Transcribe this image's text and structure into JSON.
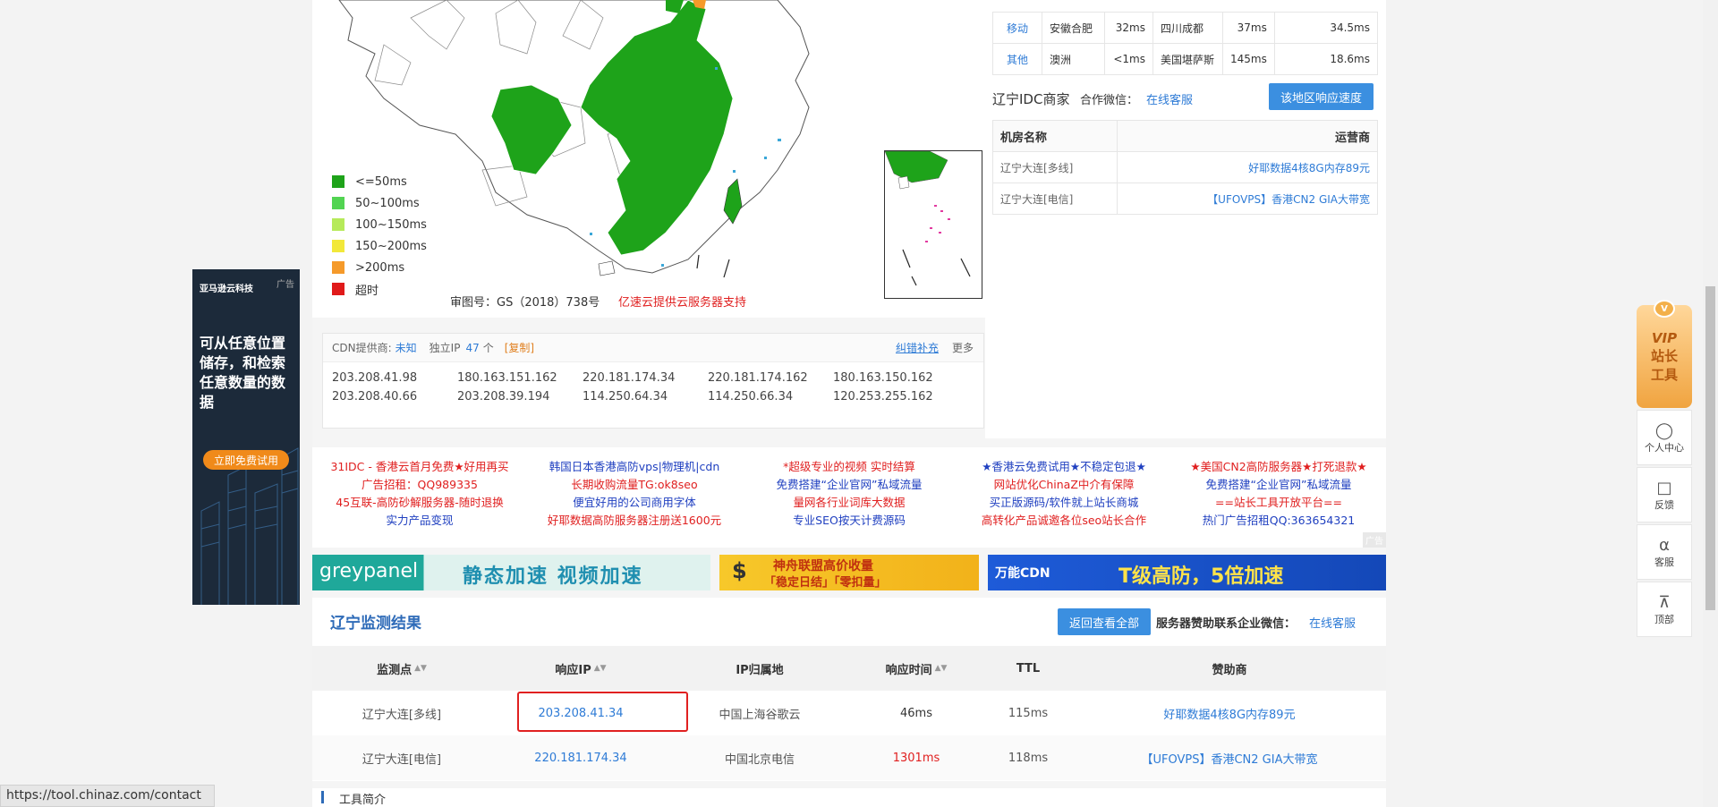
{
  "map": {
    "legend": [
      {
        "label": "<=50ms",
        "color": "#1ea31a"
      },
      {
        "label": "50~100ms",
        "color": "#52d452"
      },
      {
        "label": "100~150ms",
        "color": "#b6ea5a"
      },
      {
        "label": "150~200ms",
        "color": "#f2e83a"
      },
      {
        "label": ">200ms",
        "color": "#f59a2a"
      },
      {
        "label": "超时",
        "color": "#e01a1a"
      }
    ],
    "approval": "审图号：GS（2018）738号",
    "provider": "亿速云提供云服务器支持"
  },
  "top_table": {
    "rows": [
      {
        "isp": "移动",
        "loc1": "安徽合肥",
        "t1": "32ms",
        "loc2": "四川成都",
        "t2": "37ms",
        "avg": "34.5ms"
      },
      {
        "isp": "其他",
        "loc1": "澳洲",
        "t1": "<1ms",
        "loc2": "美国堪萨斯",
        "t2": "145ms",
        "avg": "18.6ms"
      }
    ]
  },
  "idc": {
    "title": "辽宁IDC商家",
    "wechat_label": "合作微信：",
    "wechat_link": "在线客服",
    "button": "该地区响应速度",
    "col_room": "机房名称",
    "col_isp": "运营商",
    "rows": [
      {
        "room": "辽宁大连[多线]",
        "isp": "好耶数据4核8G内存89元"
      },
      {
        "room": "辽宁大连[电信]",
        "isp": "【UFOVPS】香港CN2 GIA大带宽"
      }
    ]
  },
  "cdn": {
    "provider_label": "CDN提供商:",
    "provider_value": "未知",
    "ip_label": "独立IP",
    "ip_count": "47",
    "ip_unit": "个",
    "copy": "[复制]",
    "correct": "纠错补充",
    "more": "更多",
    "ips": [
      "203.208.41.98",
      "180.163.151.162",
      "220.181.174.34",
      "220.181.174.162",
      "180.163.150.162",
      "203.208.40.66",
      "203.208.39.194",
      "114.250.64.34",
      "114.250.66.34",
      "120.253.255.162"
    ]
  },
  "ads": {
    "columns": [
      {
        "lines": [
          "31IDC - 香港云首月免费★好用再买",
          "广告招租：QQ989335",
          "45互联-高防砂解服务器-随时退换",
          "实力产品变现"
        ],
        "colors": [
          "#e02020",
          "#e02020",
          "#e02020",
          "#2040c0"
        ]
      },
      {
        "lines": [
          "韩国日本香港高防vps|物理机|cdn",
          "长期收购流量TG:ok8seo",
          "便宜好用的公司商用字体",
          "好耶数据高防服务器注册送1600元"
        ],
        "colors": [
          "#2040c0",
          "#e02020",
          "#2040c0",
          "#e02020"
        ]
      },
      {
        "lines": [
          "*超级专业的视频 实时结算",
          "免费搭建“企业官网”私域流量",
          "量网各行业词库大数据",
          "专业SEO按天计费源码"
        ],
        "colors": [
          "#e02020",
          "#2040c0",
          "#e02020",
          "#2040c0"
        ]
      },
      {
        "lines": [
          "★香港云免费试用★不稳定包退★",
          "网站优化ChinaZ中介有保障",
          "买正版源码/软件就上站长商城",
          "高转化产品诚邀各位seo站长合作"
        ],
        "colors": [
          "#2040c0",
          "#e02020",
          "#2040c0",
          "#e02020"
        ]
      },
      {
        "lines": [
          "★美国CN2高防服务器★打死退款★",
          "免费搭建“企业官网”私域流量",
          "==站长工具开放平台==",
          "热门广告招租QQ:363654321"
        ],
        "colors": [
          "#e02020",
          "#2040c0",
          "#e02020",
          "#2040c0"
        ]
      }
    ],
    "ad_tag": "广告",
    "banner1_brand": "greypanel",
    "banner1_text": "静态加速 视频加速",
    "banner2_text1": "神舟联盟高价收量",
    "banner2_text2": "「稳定日结」「零扣量」",
    "banner3_brand": "万能CDN",
    "banner3_text": "T级高防，5倍加速"
  },
  "results": {
    "title": "辽宁监测结果",
    "back_button": "返回查看全部",
    "sponsor_label": "服务器赞助联系企业微信：",
    "sponsor_link": "在线客服",
    "headers": [
      "监测点",
      "响应IP",
      "IP归属地",
      "响应时间",
      "TTL",
      "赞助商"
    ],
    "rows": [
      {
        "point": "辽宁大连[多线]",
        "ip": "203.208.41.34",
        "loc": "中国上海谷歌云",
        "time": "46ms",
        "ttl": "115ms",
        "sponsor": "好耶数据4核8G内存89元",
        "time_color": "#333333"
      },
      {
        "point": "辽宁大连[电信]",
        "ip": "220.181.174.34",
        "loc": "中国北京电信",
        "time": "1301ms",
        "ttl": "118ms",
        "sponsor": "【UFOVPS】香港CN2 GIA大带宽",
        "time_color": "#e02020"
      }
    ],
    "next_section": "工具简介"
  },
  "left_ad": {
    "brand": "亚马逊云科技",
    "tag": "广告",
    "headline": "可从任意位置储存，和检索任意数量的数据",
    "cta": "立即免费试用"
  },
  "toolbar": {
    "vip_line1": "VIP",
    "vip_line2": "站长",
    "vip_line3": "工具",
    "items": [
      {
        "label": "个人中心",
        "icon": "user-icon"
      },
      {
        "label": "反馈",
        "icon": "feedback-icon"
      },
      {
        "label": "客服",
        "icon": "headset-icon"
      },
      {
        "label": "顶部",
        "icon": "back-to-top-icon"
      }
    ]
  },
  "status_url": "https://tool.chinaz.com/contact"
}
